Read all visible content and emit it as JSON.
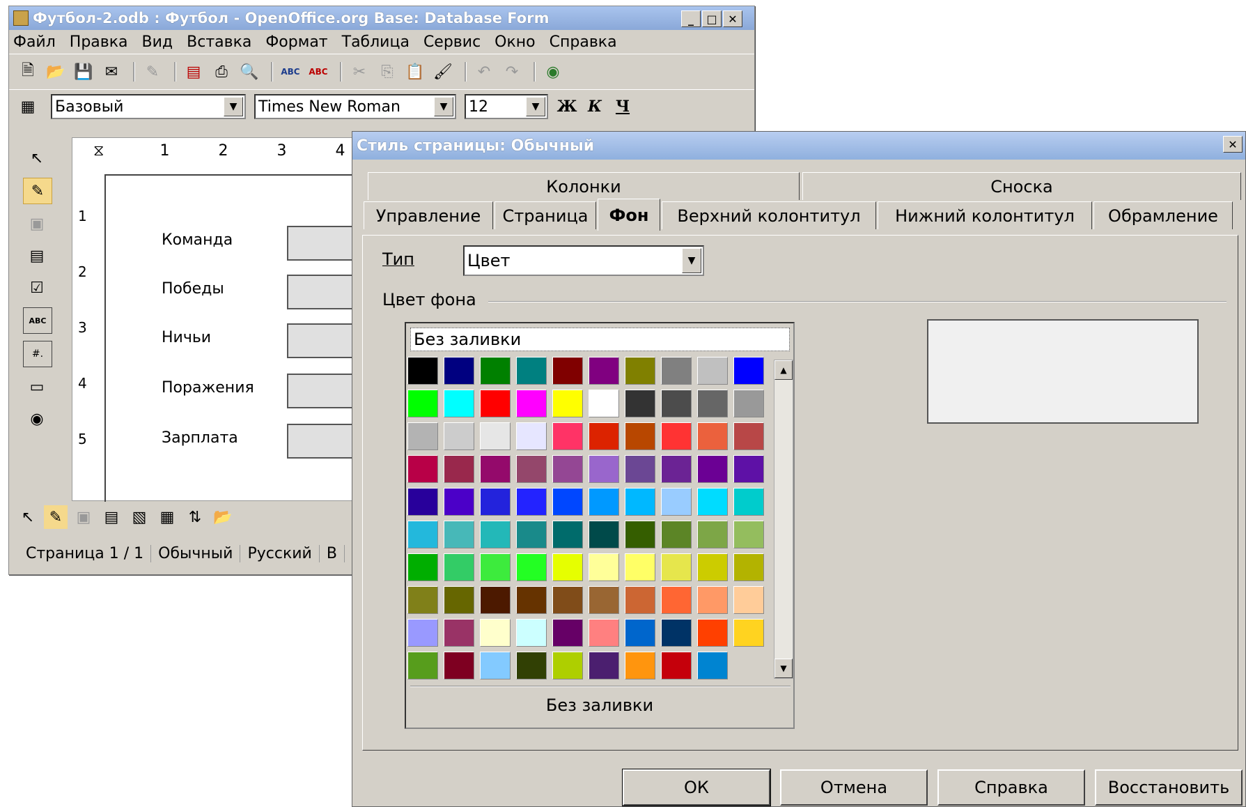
{
  "main_window": {
    "title": "Футбол-2.odb : Футбол - OpenOffice.org Base: Database Form",
    "menu": [
      "Файл",
      "Правка",
      "Вид",
      "Вставка",
      "Формат",
      "Таблица",
      "Сервис",
      "Окно",
      "Справка"
    ],
    "style_value": "Базовый",
    "font_value": "Times New Roman",
    "size_value": "12",
    "bold": "Ж",
    "italic": "К",
    "underline": "Ч",
    "ruler_numbers": [
      "1",
      "2",
      "3",
      "4"
    ],
    "vruler_numbers": [
      "1",
      "2",
      "3",
      "4",
      "5"
    ],
    "form_labels": [
      "Команда",
      "Победы",
      "Ничьи",
      "Поражения",
      "Зарплата"
    ],
    "status": [
      "Страница  1 / 1",
      "Обычный",
      "Русский",
      "В"
    ]
  },
  "dialog": {
    "title": "Стиль страницы: Обычный",
    "tabs_top": [
      "Колонки",
      "Сноска"
    ],
    "tabs_bottom": [
      "Управление",
      "Страница",
      "Фон",
      "Верхний колонтитул",
      "Нижний колонтитул",
      "Обрамление"
    ],
    "active_tab": "Фон",
    "type_label": "Тип",
    "type_value": "Цвет",
    "group_label": "Цвет фона",
    "no_fill": "Без заливки",
    "selected_color_name": "Без заливки",
    "buttons": {
      "ok": "ОК",
      "cancel": "Отмена",
      "help": "Справка",
      "reset": "Восстановить"
    },
    "palette": [
      [
        "#000000",
        "#000080",
        "#008000",
        "#008080",
        "#800000",
        "#800080",
        "#808000",
        "#808080",
        "#c0c0c0",
        "#0000ff"
      ],
      [
        "#00ff00",
        "#00ffff",
        "#ff0000",
        "#ff00ff",
        "#ffff00",
        "#ffffff",
        "#333333",
        "#4c4c4c",
        "#666666",
        "#999999"
      ],
      [
        "#b3b3b3",
        "#cccccc",
        "#e6e6e6",
        "#e6e6ff",
        "#ff3366",
        "#dc2300",
        "#b84700",
        "#ff3333",
        "#eb613d",
        "#b84747"
      ],
      [
        "#b80047",
        "#99284c",
        "#940a6b",
        "#94476b",
        "#944794",
        "#9966cc",
        "#6b4794",
        "#6b2394",
        "#6b0094",
        "#5e11a6"
      ],
      [
        "#28009b",
        "#4b00c8",
        "#2323dc",
        "#2323ff",
        "#0047ff",
        "#0099ff",
        "#00b8ff",
        "#99ccff",
        "#00dcff",
        "#00cccc"
      ],
      [
        "#23b8dc",
        "#47b8b8",
        "#23b8b8",
        "#198a8a",
        "#006b6b",
        "#004a4a",
        "#355e00",
        "#5c8526",
        "#7da647",
        "#94bd5e"
      ],
      [
        "#00ae00",
        "#33cc66",
        "#3deb3d",
        "#23ff23",
        "#e6ff00",
        "#ffff99",
        "#ffff66",
        "#e6e64c",
        "#cccc00",
        "#b3b300"
      ],
      [
        "#808019",
        "#666600",
        "#4c1900",
        "#663300",
        "#804c19",
        "#996633",
        "#cc6633",
        "#ff6633",
        "#ff9966",
        "#ffcc99"
      ],
      [
        "#9999ff",
        "#993366",
        "#ffffcc",
        "#ccffff",
        "#660066",
        "#ff8080",
        "#0066cc",
        "#003366",
        "#ff4000",
        "#ffd320"
      ],
      [
        "#579d1c",
        "#7e0021",
        "#83caff",
        "#314004",
        "#aecf00",
        "#4b1f6f",
        "#ff950e",
        "#c5000b",
        "#0084d1",
        ""
      ]
    ]
  }
}
